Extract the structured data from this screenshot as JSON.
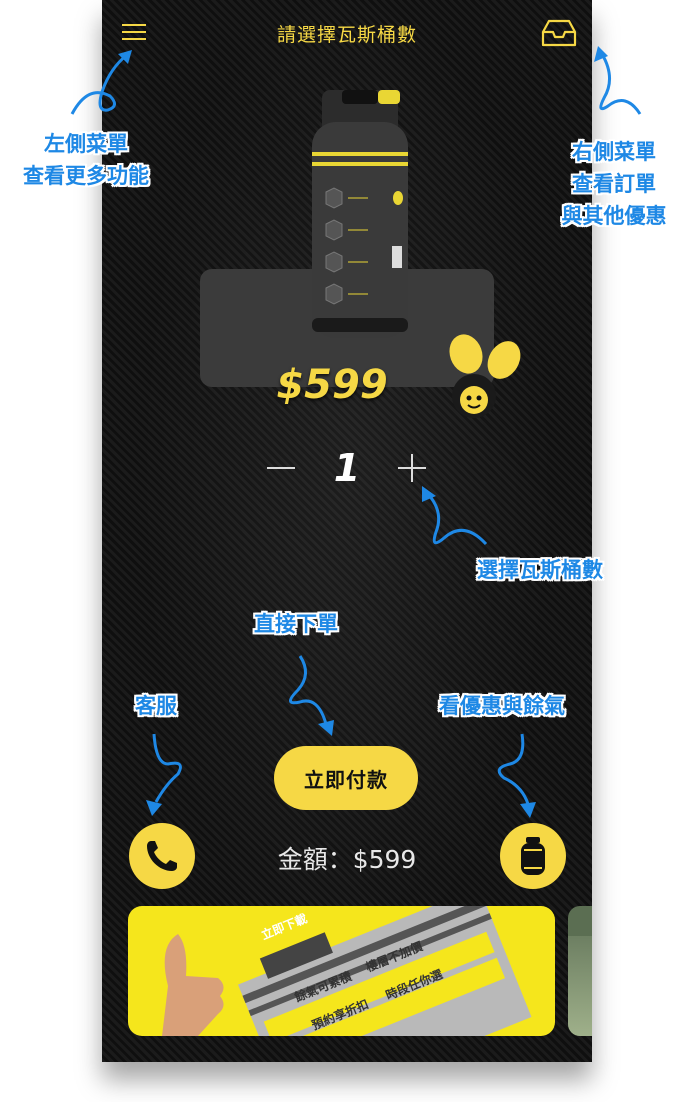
{
  "header": {
    "title": "請選擇瓦斯桶數"
  },
  "product": {
    "price": "$599"
  },
  "quantity": {
    "value": "1"
  },
  "actions": {
    "pay_label": "立即付款"
  },
  "summary": {
    "total": "金額：$599"
  },
  "banner": {
    "lines": [
      "立即下載",
      "餘氣可累積",
      "樓層不加價",
      "預約享折扣",
      "時段任你選"
    ]
  },
  "annotations": {
    "left_menu": [
      "左側菜單",
      "查看更多功能"
    ],
    "right_menu": [
      "右側菜單",
      "查看訂單",
      "與其他優惠"
    ],
    "select_qty": "選擇瓦斯桶數",
    "order_now": "直接下單",
    "support": "客服",
    "offers": "看優惠與餘氣"
  },
  "colors": {
    "accent": "#f6d845",
    "annotation": "#1e88e5",
    "background": "#111111"
  },
  "icons": [
    "hamburger-menu-icon",
    "inbox-icon",
    "phone-icon",
    "gas-cylinder-icon",
    "minus-icon",
    "plus-icon"
  ]
}
